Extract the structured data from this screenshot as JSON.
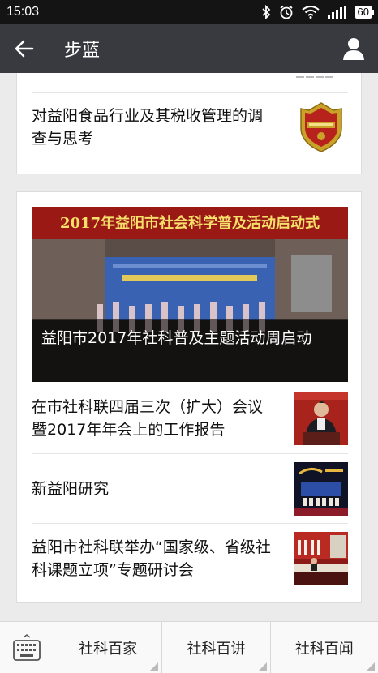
{
  "status_bar": {
    "time": "15:03",
    "battery": "60",
    "icons": [
      "bluetooth-icon",
      "alarm-icon",
      "wifi-icon",
      "signal-icon",
      "battery-icon"
    ]
  },
  "nav": {
    "title": "步蓝",
    "back_icon": "arrow-left-icon",
    "profile_icon": "person-icon"
  },
  "articles_top": [
    {
      "title": "对益阳食品行业及其税收管理的调查与思考",
      "thumb": "food-safety-badge"
    }
  ],
  "featured": {
    "banner_text": "2017年益阳市社会科学普及活动启动式",
    "caption": "益阳市2017年社科普及主题活动周启动"
  },
  "articles": [
    {
      "title": "在市社科联四届三次（扩大）会议 暨2017年年会上的工作报告",
      "thumb": "speaker-at-podium"
    },
    {
      "title": "新益阳研究",
      "thumb": "stage-performance"
    },
    {
      "title": "益阳市社科联举办“国家级、省级社科课题立项”专题研讨会",
      "thumb": "meeting-room"
    }
  ],
  "bottom_menu": {
    "keyboard_icon": "keyboard-icon",
    "items": [
      "社科百家",
      "社科百讲",
      "社科百闻"
    ]
  },
  "colors": {
    "status_bar": "#141414",
    "nav_bar": "#393a3f",
    "background": "#ebebeb",
    "card": "#ffffff"
  }
}
